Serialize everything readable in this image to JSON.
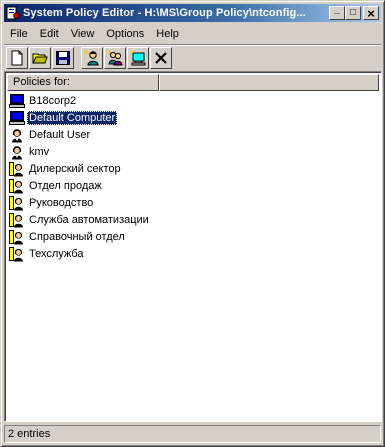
{
  "window": {
    "title": "System Policy Editor - H:\\MS\\Group Policy\\ntconfig...",
    "minimize_glyph": "_",
    "maximize_glyph": "□",
    "close_glyph": "×"
  },
  "menu": [
    "File",
    "Edit",
    "View",
    "Options",
    "Help"
  ],
  "toolbar": [
    "new-file-icon",
    "open-folder-icon",
    "save-disk-icon",
    "add-user-icon",
    "add-group-icon",
    "add-computer-icon",
    "remove-icon"
  ],
  "list": {
    "columns": [
      "Policies for:",
      ""
    ],
    "items": [
      {
        "label": "B18corp2",
        "icon": "computer-icon",
        "selected": false
      },
      {
        "label": "Default Computer",
        "icon": "computer-icon",
        "selected": true
      },
      {
        "label": "Default User",
        "icon": "user-icon",
        "selected": false
      },
      {
        "label": "kmv",
        "icon": "user-icon",
        "selected": false
      },
      {
        "label": "Дилерский сектор",
        "icon": "group-icon",
        "selected": false
      },
      {
        "label": "Отдел продаж",
        "icon": "group-icon",
        "selected": false
      },
      {
        "label": "Руководство",
        "icon": "group-icon",
        "selected": false
      },
      {
        "label": "Служба автоматизации",
        "icon": "group-icon",
        "selected": false
      },
      {
        "label": "Справочный отдел",
        "icon": "group-icon",
        "selected": false
      },
      {
        "label": "Техслужба",
        "icon": "group-icon",
        "selected": false
      }
    ]
  },
  "status": "2 entries",
  "colors": {
    "title_start": "#0a246a",
    "title_end": "#a6caf0",
    "face": "#d4d0c8",
    "selection": "#0a246a"
  }
}
